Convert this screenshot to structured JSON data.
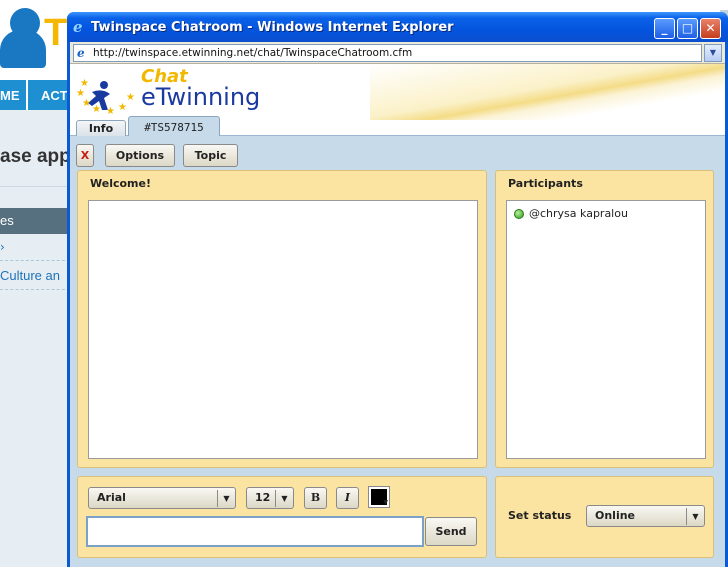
{
  "background_page": {
    "logo_letter": "T",
    "nav_items": [
      "ME",
      "ACT"
    ],
    "heading": "ase app",
    "sidebar_title": "es",
    "sidebar_link": "Culture an"
  },
  "window": {
    "title": "Twinspace Chatroom - Windows Internet Explorer",
    "controls": {
      "minimize": "_",
      "maximize": "□",
      "close": "✕"
    },
    "address": "http://twinspace.etwinning.net/chat/TwinspaceChatroom.cfm",
    "address_dropdown_icon": "chevron-down-icon"
  },
  "chat": {
    "logo": {
      "chat": "Chat",
      "brand": "eTwinning"
    },
    "tabs": [
      {
        "label": "Info"
      },
      {
        "label": "#TS578715",
        "active": true
      }
    ],
    "toolbar": {
      "close_label": "X",
      "options_label": "Options",
      "topic_label": "Topic"
    },
    "welcome_title": "Welcome!",
    "participants_title": "Participants",
    "participants": [
      {
        "name": "@chrysa kapralou",
        "status": "online",
        "status_color": "#2d9a1c"
      }
    ],
    "composer": {
      "font": "Arial",
      "size": "12",
      "bold_label": "B",
      "italic_label": "I",
      "text_color": "#000000",
      "message_value": "",
      "send_label": "Send"
    },
    "status": {
      "label": "Set status",
      "value": "Online"
    }
  },
  "colors": {
    "titlebar": "#0a5ad6",
    "chat_body": "#c6daea",
    "panel": "#fbe3a1",
    "logo_yellow": "#f2b800",
    "logo_blue": "#1a3aa0"
  }
}
